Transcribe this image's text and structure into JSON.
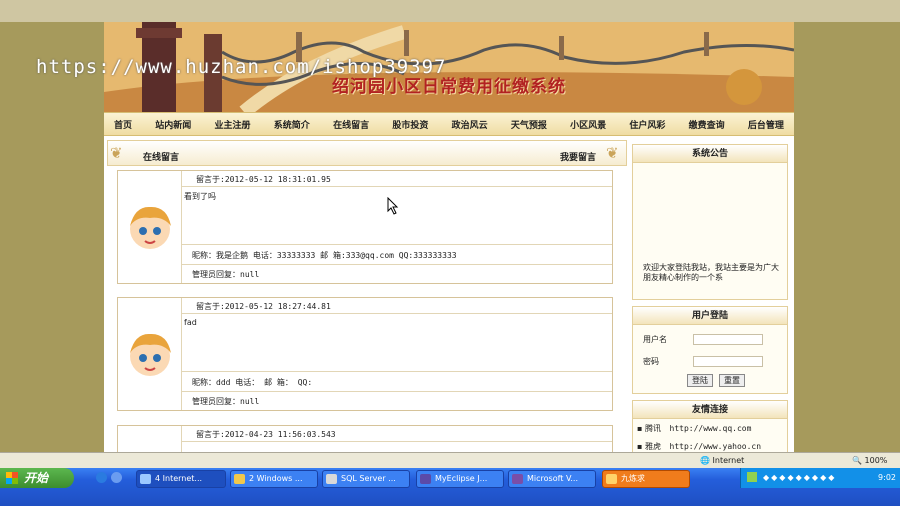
{
  "site": {
    "title": "绍河园小区日常费用征缴系统",
    "nav": [
      "首页",
      "站内新闻",
      "业主注册",
      "系统简介",
      "在线留言",
      "股市投资",
      "政治风云",
      "天气预报",
      "小区风景",
      "住户风彩",
      "缴费查询",
      "后台管理"
    ]
  },
  "section": {
    "left_title": "在线留言",
    "right_link": "我要留言"
  },
  "messages": [
    {
      "time": "留言于:2012-05-12 18:31:01.95",
      "body": "看到了吗",
      "contact": "昵称：我是企鹅    电话：33333333  邮 箱:333@qq.com     QQ:333333333",
      "reply": "管理员回复：null"
    },
    {
      "time": "留言于:2012-05-12 18:27:44.81",
      "body": "fad",
      "contact": "昵称：ddd     电话：  邮 箱：    QQ:",
      "reply": "管理员回复：null"
    },
    {
      "time": "留言于:2012-04-23 11:56:03.543",
      "body": "",
      "contact": "",
      "reply": ""
    }
  ],
  "sidebar": {
    "notice_title": "系统公告",
    "notice_text": "欢迎大家登陆我站，我站主要是为广大朋友精心制作的一个系",
    "login_title": "用户登陆",
    "username_label": "用户名",
    "password_label": "密码",
    "login_btn": "登陆",
    "reset_btn": "重置",
    "links_title": "友情连接",
    "links": [
      {
        "name": "腾讯",
        "url": "http://www.qq.com"
      },
      {
        "name": "雅虎",
        "url": "http://www.yahoo.cn"
      }
    ]
  },
  "watermark": "https://www.huzhan.com/ishop39397",
  "statusbar": {
    "zone": "Internet",
    "zoom": "100%"
  },
  "taskbar": {
    "start": "开始",
    "items": [
      "4 Internet...",
      "2 Windows ...",
      "SQL Server ...",
      "MyEclipse J...",
      "Microsoft V...",
      "九炼求"
    ],
    "clock": "9:02"
  }
}
